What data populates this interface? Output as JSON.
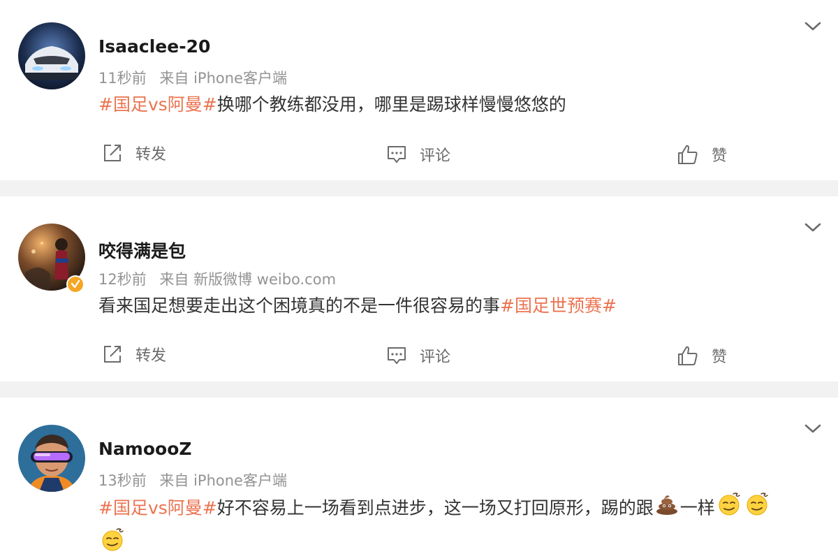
{
  "colors": {
    "topic": "#eb7350",
    "username": "#1a1a1a",
    "meta": "#939393",
    "body": "#333333",
    "actions": "#6b6b6b",
    "separator": "#f2f2f2",
    "verified_badge": "#f5a623"
  },
  "posts": [
    {
      "username": "Isaaclee-20",
      "time": "11秒前",
      "source": "来自 iPhone客户端",
      "topic_1": "#国足vs阿曼#",
      "text": "换哪个教练都没用，哪里是踢球样慢慢悠悠的",
      "repost_label": "转发",
      "comment_label": "评论",
      "like_label": "赞"
    },
    {
      "username": "咬得满是包",
      "time": "12秒前",
      "source": "来自 新版微博 weibo.com",
      "verified": true,
      "text": "看来国足想要走出这个困境真的不是一件很容易的事",
      "topic_1": "#国足世预赛#",
      "repost_label": "转发",
      "comment_label": "评论",
      "like_label": "赞"
    },
    {
      "username": "NamoooZ",
      "time": "13秒前",
      "source": "来自 iPhone客户端",
      "topic_1": "#国足vs阿曼#",
      "text_part_1": "好不容易上一场看到点进步，这一场又打回原形，踢的跟",
      "text_part_2": "一样",
      "emojis": [
        "poop-emoji",
        "smirk-emoji",
        "smirk-emoji",
        "smirk-emoji"
      ]
    }
  ],
  "icons": {
    "repost": "repost-icon",
    "comment": "comment-icon",
    "like": "like-icon",
    "more": "chevron-down-icon",
    "verified": "verified-badge-icon"
  }
}
